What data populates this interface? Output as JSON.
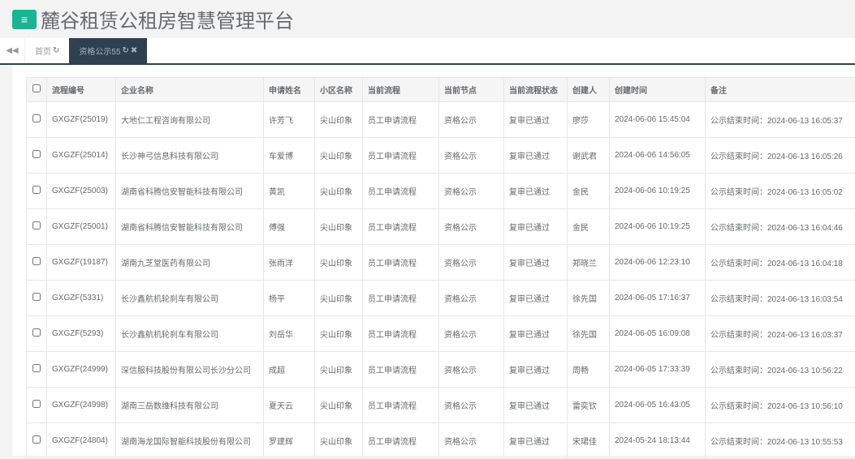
{
  "header": {
    "title": "麓谷租赁公租房智慧管理平台",
    "menu_icon": "hamburger-icon"
  },
  "tabs": [
    {
      "label": "首页",
      "active": false
    },
    {
      "label": "资格公示55",
      "active": true
    }
  ],
  "table": {
    "columns": [
      "流程编号",
      "企业名称",
      "申请姓名",
      "小区名称",
      "当前流程",
      "当前节点",
      "当前流程状态",
      "创建人",
      "创建时间",
      "备注"
    ],
    "rows": [
      [
        "GXGZF(25019)",
        "大地仁工程咨询有限公司",
        "许芳飞",
        "尖山印象",
        "员工申请流程",
        "资格公示",
        "复审已通过",
        "廖莎",
        "2024-06-06 15:45:04",
        "公示结束时间：2024-06-13 16:05:37"
      ],
      [
        "GXGZF(25014)",
        "长沙神弓信息科技有限公司",
        "车爱博",
        "尖山印象",
        "员工申请流程",
        "资格公示",
        "复审已通过",
        "谢武君",
        "2024-06-06 14:56:05",
        "公示结束时间：2024-06-13 16:05:26"
      ],
      [
        "GXGZF(25003)",
        "湖南省科腾信安智能科技有限公司",
        "黄凯",
        "尖山印象",
        "员工申请流程",
        "资格公示",
        "复审已通过",
        "金民",
        "2024-06-06 10:19:25",
        "公示结束时间：2024-06-13 16:05:02"
      ],
      [
        "GXGZF(25001)",
        "湖南省科腾信安智能科技有限公司",
        "傅强",
        "尖山印象",
        "员工申请流程",
        "资格公示",
        "复审已通过",
        "金民",
        "2024-06-06 10:19:25",
        "公示结束时间：2024-06-13 16:04:46"
      ],
      [
        "GXGZF(19187)",
        "湖南九芝堂医药有限公司",
        "张雨洋",
        "尖山印象",
        "员工申请流程",
        "资格公示",
        "复审已通过",
        "郑晓兰",
        "2024-06-06 12:23:10",
        "公示结束时间：2024-06-13 16:04:18"
      ],
      [
        "GXGZF(5331)",
        "长沙鑫航机轮刹车有限公司",
        "杨平",
        "尖山印象",
        "员工申请流程",
        "资格公示",
        "复审已通过",
        "徐先国",
        "2024-06-05 17:16:37",
        "公示结束时间：2024-06-13 16:03:54"
      ],
      [
        "GXGZF(5293)",
        "长沙鑫航机轮刹车有限公司",
        "刘岳华",
        "尖山印象",
        "员工申请流程",
        "资格公示",
        "复审已通过",
        "徐先国",
        "2024-06-05 16:09:08",
        "公示结束时间：2024-06-13 16:03:37"
      ],
      [
        "GXGZF(24999)",
        "深信服科技股份有限公司长沙分公司",
        "成超",
        "尖山印象",
        "员工申请流程",
        "资格公示",
        "复审已通过",
        "周畅",
        "2024-06-05 17:33:39",
        "公示结束时间：2024-06-13 10:56:22"
      ],
      [
        "GXGZF(24998)",
        "湖南三岳数维科技有限公司",
        "夏天云",
        "尖山印象",
        "员工申请流程",
        "资格公示",
        "复审已通过",
        "雷奕钦",
        "2024-06-05 16:43:05",
        "公示结束时间：2024-06-13 10:56:10"
      ],
      [
        "GXGZF(24804)",
        "湖南海龙国际智能科技股份有限公司",
        "罗建辉",
        "尖山印象",
        "员工申请流程",
        "资格公示",
        "复审已通过",
        "宋珺佳",
        "2024-05-24 18:13:44",
        "公示结束时间：2024-06-13 10:55:53"
      ]
    ]
  },
  "colors": {
    "accent": "#1ab394",
    "active_tab": "#2f4050"
  }
}
